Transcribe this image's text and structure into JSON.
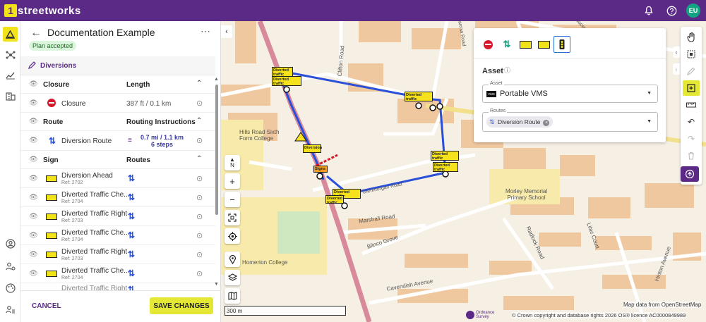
{
  "app": {
    "logo_mark": "1",
    "logo_word": "streetworks",
    "user_initials": "EU"
  },
  "topbar": {
    "bell_icon": "bell-icon",
    "help_icon": "help-icon"
  },
  "panel": {
    "title": "Documentation Example",
    "status": "Plan accepted",
    "section": "Diversions",
    "closure": {
      "header_a": "Closure",
      "header_b": "Length",
      "item": "Closure",
      "length": "387 ft / 0.1 km"
    },
    "route": {
      "header_a": "Route",
      "header_b": "Routing Instructions",
      "item": "Diversion Route",
      "distance": "0.7 mi / 1.1 km",
      "steps": "6 steps"
    },
    "sign": {
      "header_a": "Sign",
      "header_b": "Routes",
      "items": [
        {
          "name": "Diversion Ahead",
          "ref": "Ref: 2702"
        },
        {
          "name": "Diverted Traffic Che...",
          "ref": "Ref: 2704"
        },
        {
          "name": "Diverted Traffic Right",
          "ref": "Ref: 2703"
        },
        {
          "name": "Diverted Traffic Che...",
          "ref": "Ref: 2704"
        },
        {
          "name": "Diverted Traffic Right",
          "ref": "Ref: 2703"
        },
        {
          "name": "Diverted Traffic Che...",
          "ref": "Ref: 2704"
        },
        {
          "name": "Diverted Traffic Right",
          "ref": ""
        }
      ]
    },
    "cancel": "CANCEL",
    "save": "SAVE CHANGES"
  },
  "asset_card": {
    "heading": "Asset",
    "asset_label": "Asset",
    "asset_value": "Portable VMS",
    "vms_badge": "VMS",
    "routes_label": "Routes",
    "route_chip": "Diversion Route"
  },
  "map": {
    "labels": {
      "hills_road": "Hills Road Sixth\nForm College",
      "morley": "Morley Memorial\nPrimary School",
      "homerton": "Homerton College",
      "marshall": "Marshall Road",
      "blinco": "Blinco Grove",
      "cavendish": "Cavendish Avenue",
      "clifton": "Clifton Road",
      "radlock": "Radlock Road",
      "lilac": "Lilac Court",
      "hinton": "Hinton Avenue",
      "glenmorgan": "Glenmorgan Road",
      "barrow": "Barrow Road",
      "chaucer": "Chaucer Road"
    },
    "signs": [
      "Diverted traffic",
      "Diverted traffic",
      "Diverted traffic",
      "Diverted traffic",
      "Diverted traffic",
      "Diverted traffic",
      "Diverted traffic",
      "Diversion",
      "Signs"
    ],
    "compass": "N",
    "scale": "300 m",
    "attribution_1": "Map data from OpenStreetMap",
    "attribution_2": "© Crown copyright and database rights 2026 OS® licence AC0000849989",
    "os_brand_1": "Ordnance",
    "os_brand_2": "Survey"
  },
  "colors": {
    "brand": "#5b2a86",
    "accent": "#e4e834",
    "route": "#2a4fd8",
    "status_bg": "#dcf5dd"
  }
}
